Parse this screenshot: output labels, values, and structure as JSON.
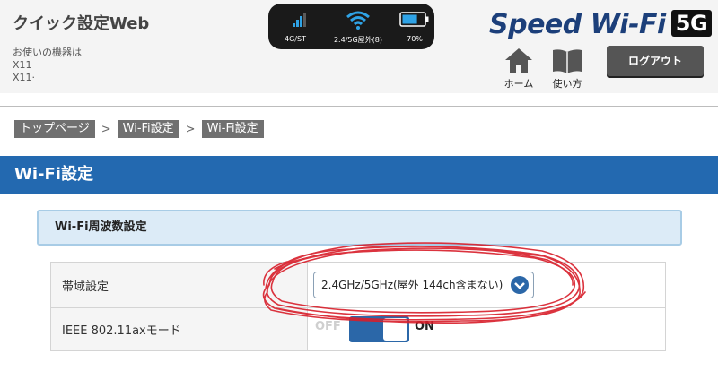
{
  "header": {
    "app_title": "クイック設定Web",
    "info_line1": "お使いの機器は",
    "info_line2": "X11",
    "info_line3": "X11·",
    "status": {
      "network_label": "4G/ST",
      "wifi_label": "2.4/5G屋外(8)",
      "battery_label": "70%",
      "battery_level": 0.7
    },
    "brand": {
      "text": "Speed Wi-Fi",
      "badge": "5G"
    },
    "nav": {
      "home_label": "ホーム",
      "manual_label": "使い方"
    },
    "logout_label": "ログアウト"
  },
  "breadcrumb": {
    "items": [
      "トップページ",
      "Wi-Fi設定",
      "Wi-Fi設定"
    ],
    "separator": ">"
  },
  "page_title": "Wi-Fi設定",
  "section": {
    "title": "Wi-Fi周波数設定",
    "rows": [
      {
        "label": "帯域設定",
        "select_value": "2.4GHz/5GHz(屋外 144ch含まない)"
      },
      {
        "label": "IEEE 802.11axモード",
        "toggle_off_label": "OFF",
        "toggle_on_label": "ON",
        "toggle_state": "on"
      }
    ]
  },
  "colors": {
    "accent_blue": "#2369b0",
    "brand_navy": "#1c3f7a",
    "scribble_red": "#d81e2a"
  }
}
